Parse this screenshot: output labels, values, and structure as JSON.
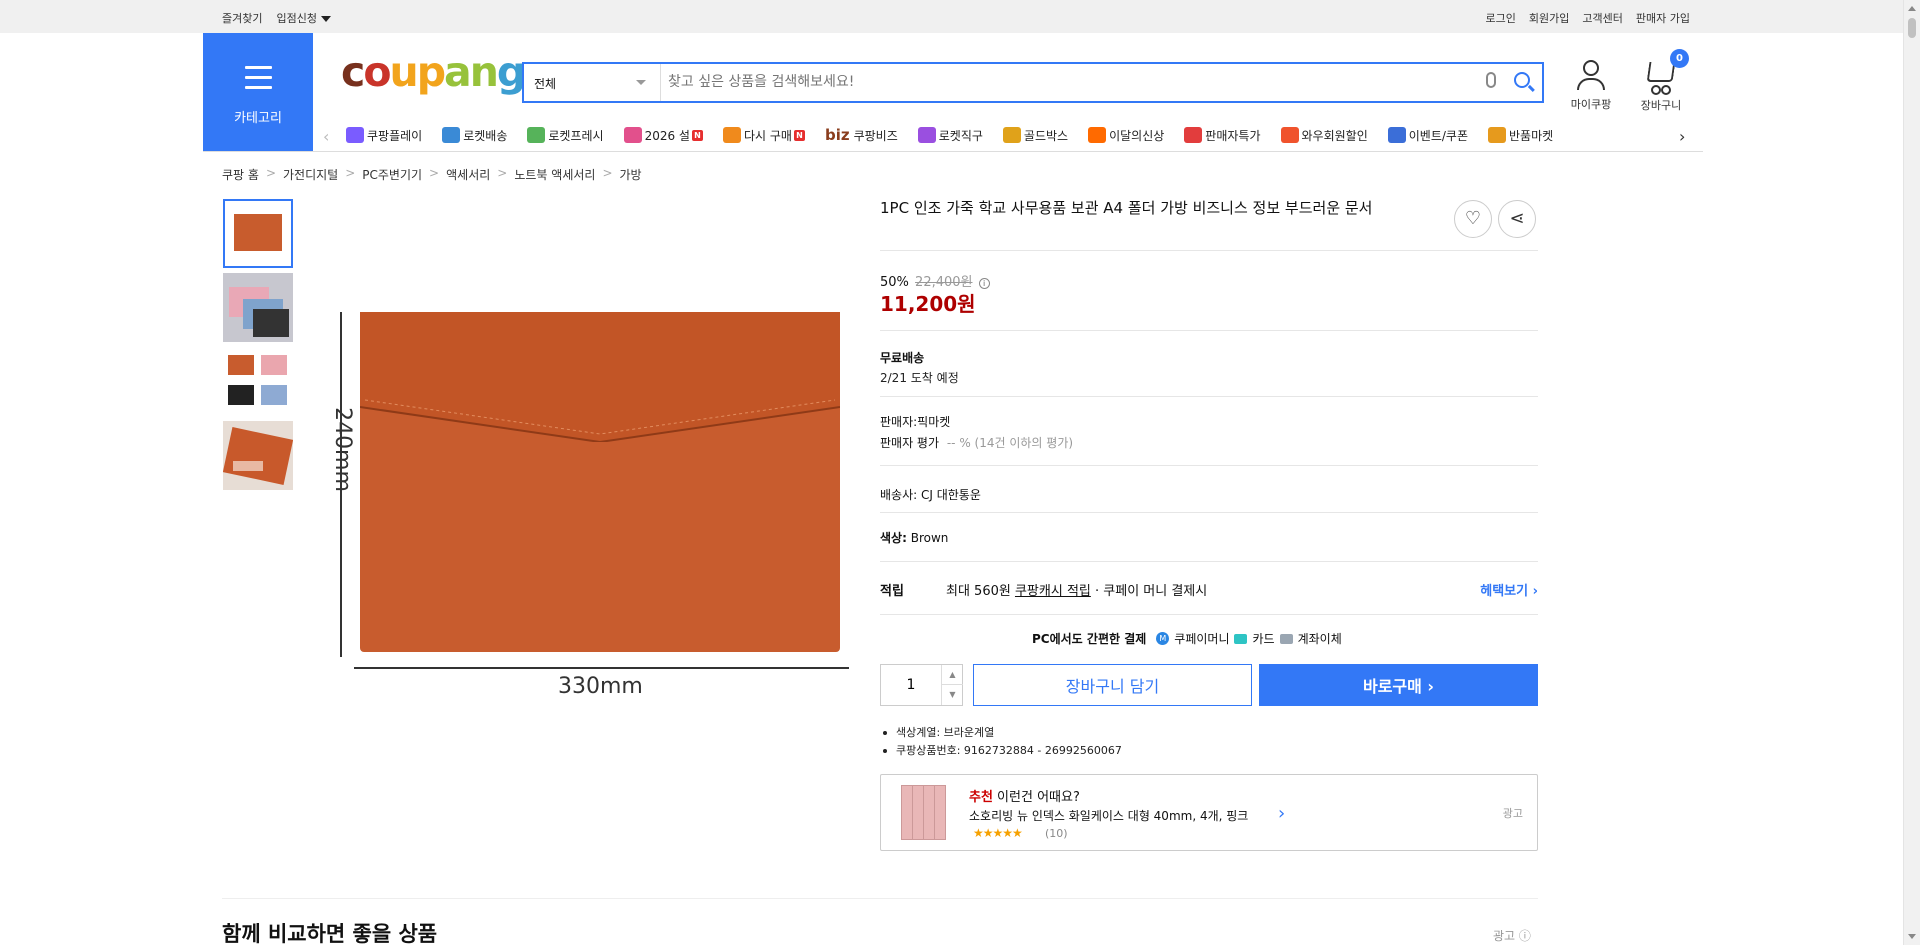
{
  "topbar": {
    "left": [
      "즐겨찾기",
      "입점신청"
    ],
    "right": [
      "로그인",
      "회원가입",
      "고객센터",
      "판매자 가입"
    ]
  },
  "header": {
    "category_label": "카테고리",
    "logo": "coupang",
    "search_scope": "전체",
    "search_placeholder": "찾고 싶은 상품을 검색해보세요!",
    "mycoupang": "마이쿠팡",
    "cart_label": "장바구니",
    "cart_count": "0"
  },
  "catnav": [
    {
      "label": "쿠팡플레이",
      "icon": "play-icon",
      "color": "#7a5cff"
    },
    {
      "label": "로켓배송",
      "icon": "rocket-icon",
      "color": "#3a8ad6"
    },
    {
      "label": "로켓프레시",
      "icon": "rocket-fresh-icon",
      "color": "#56b35a"
    },
    {
      "label": "2026 설",
      "icon": "gift-icon",
      "color": "#e2508c",
      "badge": "N"
    },
    {
      "label": "다시 구매",
      "icon": "home-icon",
      "color": "#f08a1c",
      "badge": "N"
    },
    {
      "label": "쿠팡비즈",
      "icon": "biz-icon",
      "color": "#8a3d1d",
      "prefix": "biz"
    },
    {
      "label": "로켓직구",
      "icon": "global-icon",
      "color": "#9a4fe0"
    },
    {
      "label": "골드박스",
      "icon": "goldbox-icon",
      "color": "#e0a21a"
    },
    {
      "label": "이달의신상",
      "icon": "new-icon",
      "color": "#ff6a00"
    },
    {
      "label": "판매자특가",
      "icon": "percent-icon",
      "color": "#e23d3d"
    },
    {
      "label": "와우회원할인",
      "icon": "wow-icon",
      "color": "#f0532d"
    },
    {
      "label": "이벤트/쿠폰",
      "icon": "coupon-icon",
      "color": "#3b6ed8"
    },
    {
      "label": "반품마켓",
      "icon": "market-icon",
      "color": "#e69a1d"
    }
  ],
  "breadcrumb": [
    "쿠팡 홈",
    "가전디지털",
    "PC주변기기",
    "액세서리",
    "노트북 액세서리",
    "가방"
  ],
  "product": {
    "title": "1PC 인조 가죽 학교 사무용품 보관 A4 폴더 가방 비즈니스 정보 부드러운 문서",
    "discount": "50%",
    "orig_price": "22,400원",
    "price": "11,200원",
    "shipping_title": "무료배송",
    "shipping_eta": "2/21 도착 예정",
    "seller": "판매자:픽마켓",
    "seller_rating_label": "판매자 평가",
    "seller_rating_value": "-- % (14건 이하의 평가)",
    "carrier": "배송사:  CJ 대한통운",
    "color_label": "색상:",
    "color_value": "Brown",
    "reward_label": "적립",
    "reward_text_pre": "최대 560원",
    "reward_text_link": "쿠팡캐시 적립",
    "reward_text_post": "· 쿠페이 머니 결제시",
    "reward_more": "헤택보기 ›",
    "pay_title": "PC에서도 간편한 결제",
    "pay_methods": [
      "쿠페이머니",
      "카드",
      "계좌이체"
    ],
    "qty": "1",
    "cart_btn": "장바구니 담기",
    "buy_btn": "바로구매 ›",
    "bullets": [
      "색상계열: 브라운계열",
      "쿠팡상품번호: 9162732884 - 26992560067"
    ],
    "dim_h": "330mm",
    "dim_v": "240mm",
    "color_swatch": "#c85c2e"
  },
  "recommend": {
    "head_red": "추천",
    "head": " 이런건 어때요?",
    "name": "소호리빙 뉴 인덱스 화일케이스 대형 40mm, 4개, 핑크",
    "stars": "★★★★★",
    "count": "(10)",
    "ad": "광고"
  },
  "compare": {
    "title": "함께 비교하면 좋을 상품",
    "ad": "광고 ⓘ"
  }
}
